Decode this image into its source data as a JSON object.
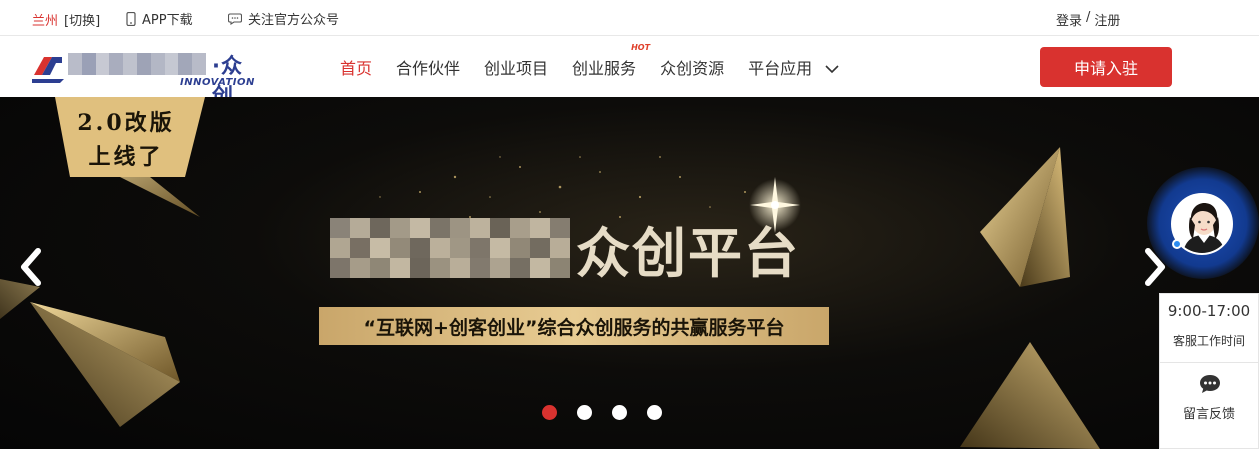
{
  "topbar": {
    "city": "兰州",
    "switch_label": "[切换]",
    "app_download": "APP下载",
    "follow_account": "关注官方公众号",
    "login": "登录",
    "separator": "/",
    "register": "注册",
    "phone_icon": "phone-icon",
    "chat_icon": "chat-bubble-icon"
  },
  "nav": {
    "brand_suffix": "·众创",
    "brand_sub": "INNOVATION",
    "items": [
      {
        "label": "首页",
        "active": true
      },
      {
        "label": "合作伙伴"
      },
      {
        "label": "创业项目"
      },
      {
        "label": "创业服务",
        "badge": "HOT"
      },
      {
        "label": "众创资源"
      },
      {
        "label": "平台应用",
        "dropdown": true
      }
    ],
    "apply_button": "申请入驻"
  },
  "banner": {
    "badge_line1": "2.0改版",
    "badge_line2": "上线了",
    "headline_suffix": "众创平台",
    "slogan": "“互联网+创客创业”综合众创服务的共赢服务平台",
    "slide_count": 4,
    "active_slide": 1
  },
  "support": {
    "hours": "9:00-17:00",
    "hours_label": "客服工作时间",
    "feedback_label": "留言反馈"
  },
  "colors": {
    "accent_red": "#d9322f",
    "brand_blue": "#2c3e91",
    "gold": "#d8b77a"
  }
}
